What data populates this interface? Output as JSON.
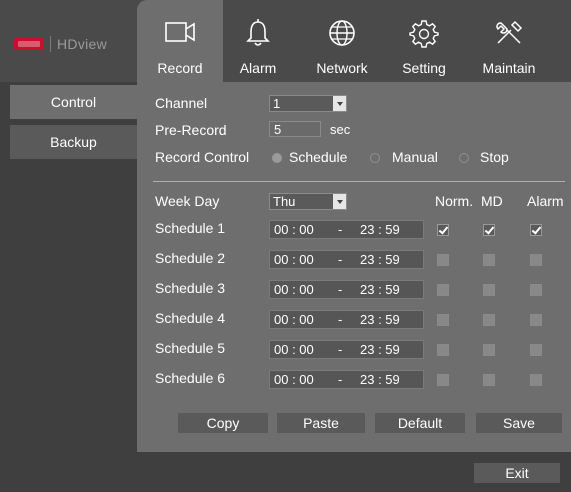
{
  "brand": {
    "name": "HDview"
  },
  "tabs": [
    {
      "label": "Record",
      "icon": "camera-icon",
      "active": true
    },
    {
      "label": "Alarm",
      "icon": "bell-icon",
      "active": false
    },
    {
      "label": "Network",
      "icon": "globe-icon",
      "active": false
    },
    {
      "label": "Setting",
      "icon": "gear-icon",
      "active": false
    },
    {
      "label": "Maintain",
      "icon": "tools-icon",
      "active": false
    }
  ],
  "sidebar": {
    "items": [
      {
        "label": "Control",
        "active": true
      },
      {
        "label": "Backup",
        "active": false
      }
    ]
  },
  "form": {
    "channel_label": "Channel",
    "channel_value": "1",
    "prerecord_label": "Pre-Record",
    "prerecord_value": "5",
    "prerecord_unit": "sec",
    "record_control_label": "Record Control",
    "options": [
      "Schedule",
      "Manual",
      "Stop"
    ],
    "selected_option": "Schedule"
  },
  "schedule": {
    "weekday_label": "Week Day",
    "weekday_value": "Thu",
    "col_headers": [
      "Norm.",
      "MD",
      "Alarm"
    ],
    "rows": [
      {
        "label": "Schedule 1",
        "start": "00 : 00",
        "sep": "-",
        "end": "23 : 59",
        "norm": true,
        "md": true,
        "alarm": true
      },
      {
        "label": "Schedule 2",
        "start": "00 : 00",
        "sep": "-",
        "end": "23 : 59",
        "norm": false,
        "md": false,
        "alarm": false
      },
      {
        "label": "Schedule 3",
        "start": "00 : 00",
        "sep": "-",
        "end": "23 : 59",
        "norm": false,
        "md": false,
        "alarm": false
      },
      {
        "label": "Schedule 4",
        "start": "00 : 00",
        "sep": "-",
        "end": "23 : 59",
        "norm": false,
        "md": false,
        "alarm": false
      },
      {
        "label": "Schedule 5",
        "start": "00 : 00",
        "sep": "-",
        "end": "23 : 59",
        "norm": false,
        "md": false,
        "alarm": false
      },
      {
        "label": "Schedule 6",
        "start": "00 : 00",
        "sep": "-",
        "end": "23 : 59",
        "norm": false,
        "md": false,
        "alarm": false
      }
    ]
  },
  "buttons": {
    "copy": "Copy",
    "paste": "Paste",
    "default": "Default",
    "save": "Save",
    "exit": "Exit"
  },
  "colors": {
    "panel": "#6e6e6e",
    "background": "#3f3f3f",
    "brand_red": "#c8102e"
  }
}
